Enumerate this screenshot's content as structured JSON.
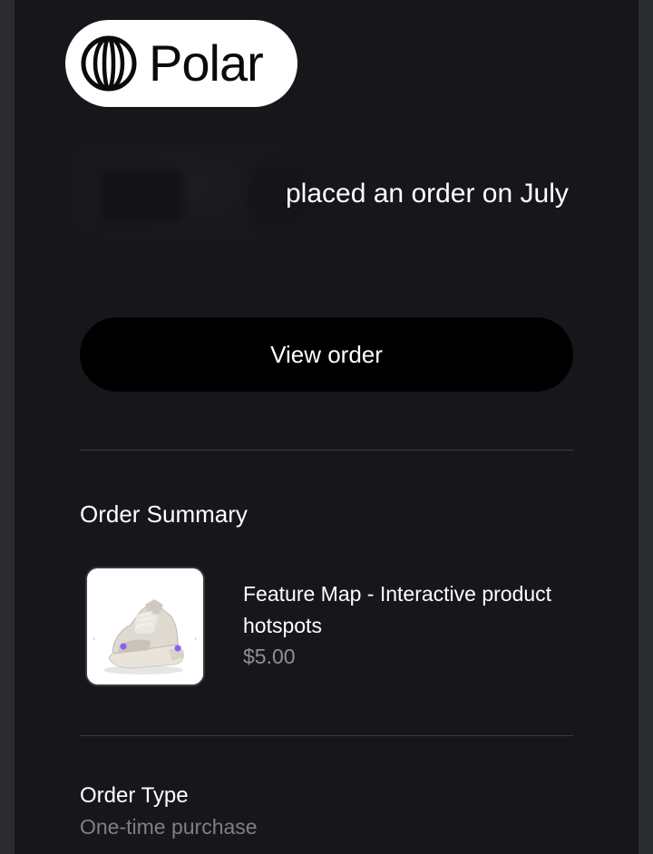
{
  "brand": {
    "name": "Polar"
  },
  "header": {
    "headline": "placed an order on July"
  },
  "actions": {
    "view_order": "View order"
  },
  "summary": {
    "title": "Order Summary",
    "item": {
      "name": "Feature Map - Interactive product hotspots",
      "price": "$5.00",
      "thumbnail_icon": "sneaker-image"
    }
  },
  "order_type": {
    "label": "Order Type",
    "value": "One-time purchase"
  },
  "colors": {
    "background": "#17171b",
    "button": "#000000",
    "text_primary": "#ffffff",
    "text_muted": "#8d8f99",
    "hotspot_accent": "#8a5cf6"
  }
}
